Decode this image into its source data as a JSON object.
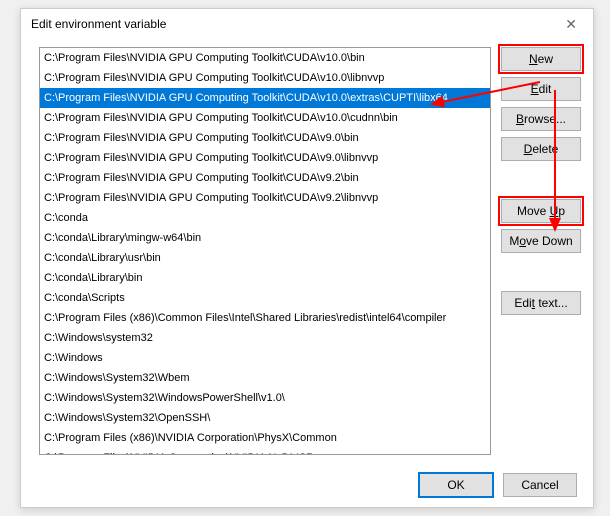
{
  "dialog": {
    "title": "Edit environment variable"
  },
  "list": {
    "selected_index": 2,
    "items": [
      "C:\\Program Files\\NVIDIA GPU Computing Toolkit\\CUDA\\v10.0\\bin",
      "C:\\Program Files\\NVIDIA GPU Computing Toolkit\\CUDA\\v10.0\\libnvvp",
      "C:\\Program Files\\NVIDIA GPU Computing Toolkit\\CUDA\\v10.0\\extras\\CUPTI\\libx64",
      "C:\\Program Files\\NVIDIA GPU Computing Toolkit\\CUDA\\v10.0\\cudnn\\bin",
      "C:\\Program Files\\NVIDIA GPU Computing Toolkit\\CUDA\\v9.0\\bin",
      "C:\\Program Files\\NVIDIA GPU Computing Toolkit\\CUDA\\v9.0\\libnvvp",
      "C:\\Program Files\\NVIDIA GPU Computing Toolkit\\CUDA\\v9.2\\bin",
      "C:\\Program Files\\NVIDIA GPU Computing Toolkit\\CUDA\\v9.2\\libnvvp",
      "C:\\conda",
      "C:\\conda\\Library\\mingw-w64\\bin",
      "C:\\conda\\Library\\usr\\bin",
      "C:\\conda\\Library\\bin",
      "C:\\conda\\Scripts",
      "C:\\Program Files (x86)\\Common Files\\Intel\\Shared Libraries\\redist\\intel64\\compiler",
      "C:\\Windows\\system32",
      "C:\\Windows",
      "C:\\Windows\\System32\\Wbem",
      "C:\\Windows\\System32\\WindowsPowerShell\\v1.0\\",
      "C:\\Windows\\System32\\OpenSSH\\",
      "C:\\Program Files (x86)\\NVIDIA Corporation\\PhysX\\Common",
      "C:\\Program Files\\NVIDIA Corporation\\NVIDIA NvDLISR"
    ]
  },
  "buttons": {
    "new": "New",
    "edit": "Edit",
    "browse": "Browse...",
    "delete": "Delete",
    "move_up": "Move Up",
    "move_down": "Move Down",
    "edit_text": "Edit text...",
    "ok": "OK",
    "cancel": "Cancel"
  },
  "mnemonics": {
    "new": "N",
    "edit": "E",
    "browse": "B",
    "delete": "D",
    "move_up": "U",
    "move_down": "o",
    "edit_text": "t"
  },
  "annotation": {
    "color": "#ff0000",
    "highlighted_buttons": [
      "new-button",
      "move-up-button"
    ]
  }
}
